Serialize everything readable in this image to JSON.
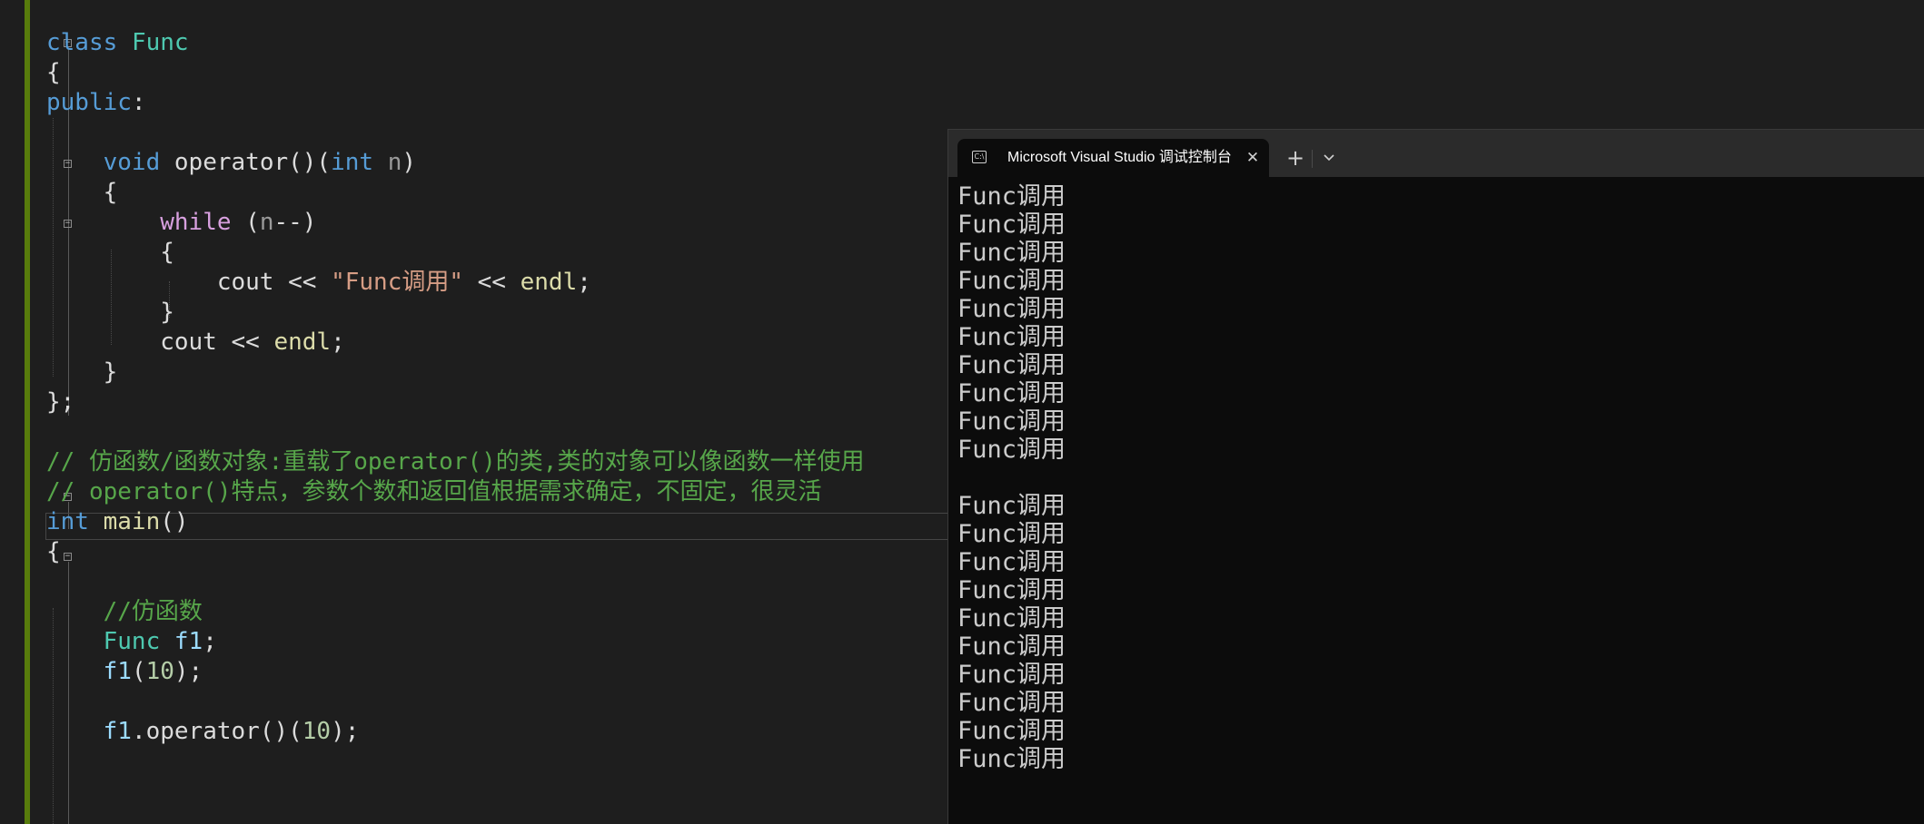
{
  "editor": {
    "lines": [
      {
        "tokens": [
          {
            "t": "class",
            "c": "kw"
          },
          {
            "t": " ",
            "c": "pl"
          },
          {
            "t": "Func",
            "c": "typ"
          }
        ]
      },
      {
        "tokens": [
          {
            "t": "{",
            "c": "pl"
          }
        ]
      },
      {
        "tokens": [
          {
            "t": "public",
            "c": "kw"
          },
          {
            "t": ":",
            "c": "pl"
          }
        ]
      },
      {
        "tokens": []
      },
      {
        "tokens": [
          {
            "t": "    ",
            "c": "pl"
          },
          {
            "t": "void",
            "c": "kw"
          },
          {
            "t": " operator()(",
            "c": "pl"
          },
          {
            "t": "int",
            "c": "kw"
          },
          {
            "t": " ",
            "c": "pl"
          },
          {
            "t": "n",
            "c": "prm"
          },
          {
            "t": ")",
            "c": "pl"
          }
        ]
      },
      {
        "tokens": [
          {
            "t": "    {",
            "c": "pl"
          }
        ]
      },
      {
        "tokens": [
          {
            "t": "        ",
            "c": "pl"
          },
          {
            "t": "while",
            "c": "ctl"
          },
          {
            "t": " (",
            "c": "pl"
          },
          {
            "t": "n",
            "c": "prm"
          },
          {
            "t": "--)",
            "c": "pl"
          }
        ]
      },
      {
        "tokens": [
          {
            "t": "        {",
            "c": "pl"
          }
        ]
      },
      {
        "tokens": [
          {
            "t": "            cout << ",
            "c": "pl"
          },
          {
            "t": "\"Func调用\"",
            "c": "str"
          },
          {
            "t": " << ",
            "c": "pl"
          },
          {
            "t": "endl",
            "c": "fn"
          },
          {
            "t": ";",
            "c": "pl"
          }
        ]
      },
      {
        "tokens": [
          {
            "t": "        }",
            "c": "pl"
          }
        ]
      },
      {
        "tokens": [
          {
            "t": "        cout << ",
            "c": "pl"
          },
          {
            "t": "endl",
            "c": "fn"
          },
          {
            "t": ";",
            "c": "pl"
          }
        ]
      },
      {
        "tokens": [
          {
            "t": "    }",
            "c": "pl"
          }
        ]
      },
      {
        "tokens": [
          {
            "t": "};",
            "c": "pl"
          }
        ]
      },
      {
        "tokens": []
      },
      {
        "tokens": [
          {
            "t": "// 仿函数/函数对象:重载了operator()的类,类的对象可以像函数一样使用",
            "c": "cmt"
          }
        ]
      },
      {
        "tokens": [
          {
            "t": "// operator()特点，参数个数和返回值根据需求确定，不固定，很灵活",
            "c": "cmt"
          }
        ]
      },
      {
        "tokens": [
          {
            "t": "int",
            "c": "kw"
          },
          {
            "t": " ",
            "c": "pl"
          },
          {
            "t": "main",
            "c": "fn"
          },
          {
            "t": "()",
            "c": "pl"
          }
        ]
      },
      {
        "tokens": [
          {
            "t": "{",
            "c": "pl"
          }
        ]
      },
      {
        "tokens": []
      },
      {
        "tokens": [
          {
            "t": "    ",
            "c": "pl"
          },
          {
            "t": "//仿函数",
            "c": "cmt"
          }
        ]
      },
      {
        "tokens": [
          {
            "t": "    ",
            "c": "pl"
          },
          {
            "t": "Func",
            "c": "typ"
          },
          {
            "t": " ",
            "c": "pl"
          },
          {
            "t": "f1",
            "c": "var"
          },
          {
            "t": ";",
            "c": "pl"
          }
        ]
      },
      {
        "tokens": [
          {
            "t": "    ",
            "c": "pl"
          },
          {
            "t": "f1",
            "c": "var"
          },
          {
            "t": "(",
            "c": "pl"
          },
          {
            "t": "10",
            "c": "num"
          },
          {
            "t": ");",
            "c": "pl"
          }
        ]
      },
      {
        "tokens": []
      },
      {
        "tokens": [
          {
            "t": "    ",
            "c": "pl"
          },
          {
            "t": "f1",
            "c": "var"
          },
          {
            "t": ".operator()(",
            "c": "pl"
          },
          {
            "t": "10",
            "c": "num"
          },
          {
            "t": ");",
            "c": "pl"
          }
        ]
      }
    ]
  },
  "terminal": {
    "tab_icon": "terminal-app-icon",
    "tab_icon_glyph": "C:\\",
    "tab_title": "Microsoft Visual Studio 调试控制台",
    "close_glyph": "✕",
    "new_tab_glyph": "+",
    "dropdown_icon": "chevron-down-icon",
    "output_lines": [
      "Func调用",
      "Func调用",
      "Func调用",
      "Func调用",
      "Func调用",
      "Func调用",
      "Func调用",
      "Func调用",
      "Func调用",
      "Func调用",
      "",
      "Func调用",
      "Func调用",
      "Func调用",
      "Func调用",
      "Func调用",
      "Func调用",
      "Func调用",
      "Func调用",
      "Func调用",
      "Func调用"
    ]
  },
  "colors": {
    "editor_bg": "#1e1e1e",
    "change_bar": "#587c0c",
    "keyword": "#569cd6",
    "control": "#d8a0df",
    "type": "#4ec9b0",
    "function": "#dcdcaa",
    "string": "#d69d85",
    "comment": "#57a64a",
    "number": "#b5cea8",
    "terminal_bg": "#0c0c0c",
    "terminal_text": "#cccccc"
  }
}
